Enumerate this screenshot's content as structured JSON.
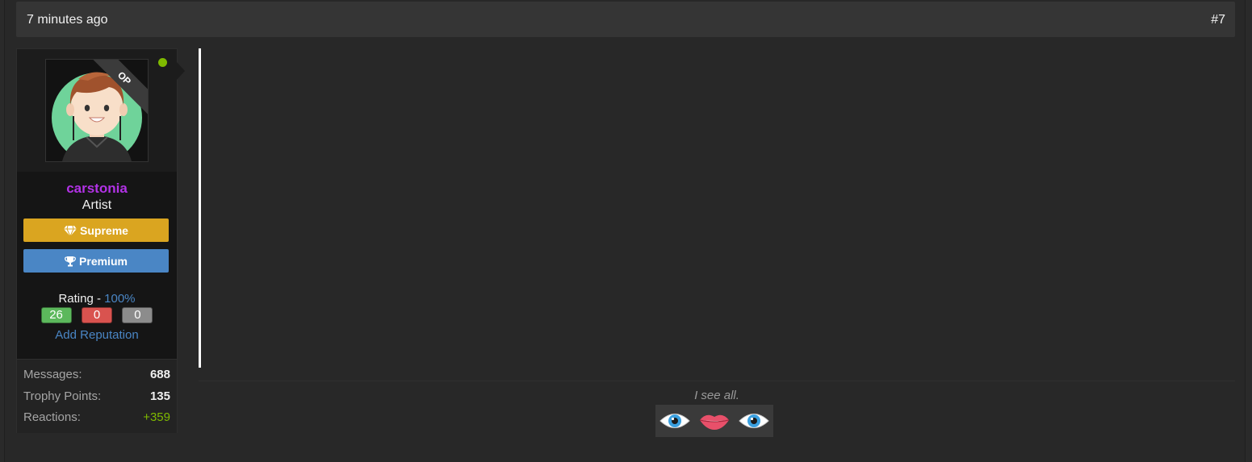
{
  "post": {
    "time": "7 minutes ago",
    "number": "#7"
  },
  "user": {
    "op_label": "OP",
    "username": "carstonia",
    "title": "Artist",
    "banners": {
      "supreme": "Supreme",
      "premium": "Premium"
    },
    "rating": {
      "label": "Rating - ",
      "percent": "100%",
      "positive": "26",
      "negative": "0",
      "neutral": "0"
    },
    "add_reputation": "Add Reputation",
    "stats": [
      {
        "label": "Messages:",
        "value": "688"
      },
      {
        "label": "Trophy Points:",
        "value": "135"
      },
      {
        "label": "Reactions:",
        "value": "+359"
      }
    ]
  },
  "signature": {
    "text": "I see all."
  },
  "colors": {
    "username": "#b232e6",
    "supreme": "#daa520",
    "premium": "#4a86c5",
    "online": "#7fba00",
    "link": "#4a86c5"
  },
  "icons": {
    "supreme": "diamond-icon",
    "premium": "trophy-icon",
    "emojis": [
      "eye-icon",
      "lips-icon",
      "eye-icon"
    ]
  }
}
